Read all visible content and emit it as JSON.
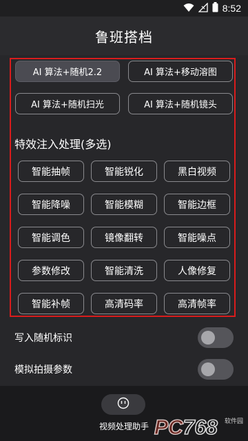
{
  "status_bar": {
    "time": "8:52"
  },
  "header": {
    "title": "鲁班搭档"
  },
  "algorithms": [
    {
      "label": "AI 算法+随机2.2",
      "selected": true
    },
    {
      "label": "AI 算法+移动溶图",
      "selected": false
    },
    {
      "label": "AI 算法+随机扫光",
      "selected": false
    },
    {
      "label": "AI 算法+随机镜头",
      "selected": false
    }
  ],
  "effects": {
    "title": "特效注入处理(多选)",
    "items": [
      "智能抽帧",
      "智能锐化",
      "黑白视频",
      "智能降噪",
      "智能模糊",
      "智能边框",
      "智能调色",
      "镜像翻转",
      "智能噪点",
      "参数修改",
      "智能清洗",
      "人像修复",
      "智能补帧",
      "高清码率",
      "高清帧率"
    ]
  },
  "settings": {
    "random_mark_label": "写入随机标识",
    "simulate_params_label": "模拟拍摄参数"
  },
  "bottom": {
    "assistant_label": "视频处理助手"
  },
  "watermark": {
    "text": "PC768",
    "sub": "软件园"
  },
  "colors": {
    "highlight": "#d91c1c",
    "selected_bg": "#4b4b52",
    "accent_wm": "#e23b2a"
  }
}
